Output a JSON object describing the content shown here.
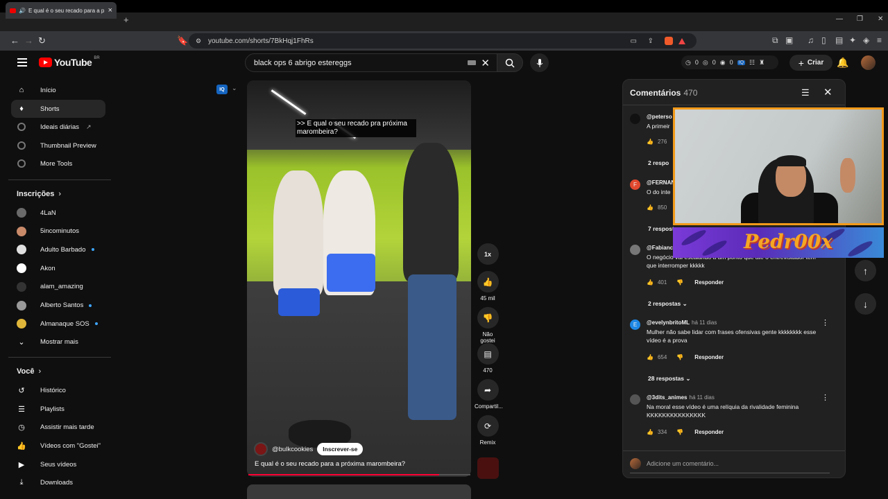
{
  "browser": {
    "tab_title": "E qual é o seu recado para a p",
    "url": "youtube.com/shorts/7BkHqj1FhRs"
  },
  "header": {
    "logo_text": "YouTube",
    "logo_country": "BR",
    "search_value": "black ops 6 abrigo estereggs",
    "counters": [
      "0",
      "0",
      "0"
    ],
    "create_label": "Criar"
  },
  "sidebar": {
    "main": [
      {
        "label": "Início",
        "icon": "home-icon"
      },
      {
        "label": "Shorts",
        "icon": "shorts-icon"
      },
      {
        "label": "Ideais diárias",
        "icon": "gear-icon"
      },
      {
        "label": "Thumbnail Preview",
        "icon": "gear-icon"
      },
      {
        "label": "More Tools",
        "icon": "gear-icon"
      }
    ],
    "subscriptions_header": "Inscrições",
    "subscriptions": [
      {
        "label": "4LaN",
        "dot": false,
        "color": "#6a6a6a"
      },
      {
        "label": "5incominutos",
        "dot": false,
        "color": "#c98a6a"
      },
      {
        "label": "Adulto Barbado",
        "dot": true,
        "color": "#e0e0e0"
      },
      {
        "label": "Akon",
        "dot": false,
        "color": "#ffffff"
      },
      {
        "label": "alam_amazing",
        "dot": false,
        "color": "#333333"
      },
      {
        "label": "Alberto Santos",
        "dot": true,
        "color": "#999999"
      },
      {
        "label": "Almanaque SOS",
        "dot": true,
        "color": "#e0b63a"
      }
    ],
    "show_more": "Mostrar mais",
    "you_header": "Você",
    "you_items": [
      {
        "label": "Histórico",
        "icon": "history-icon"
      },
      {
        "label": "Playlists",
        "icon": "playlists-icon"
      },
      {
        "label": "Assistir mais tarde",
        "icon": "clock-icon"
      },
      {
        "label": "Vídeos com \"Gostei\"",
        "icon": "like-icon"
      },
      {
        "label": "Seus vídeos",
        "icon": "video-icon"
      },
      {
        "label": "Downloads",
        "icon": "download-icon"
      }
    ]
  },
  "video": {
    "caption": ">> E qual o seu recado pra próxima marombeira?",
    "channel": "@bulkcookies",
    "subscribe_label": "Inscrever-se",
    "title": "E qual é o seu recado para a próxima marombeira?",
    "progress": 0.86
  },
  "actions": {
    "speed": "1x",
    "likes": "45 mil",
    "dislike_label": "Não gostei",
    "comments": "470",
    "share_label": "Compartil...",
    "remix_label": "Remix"
  },
  "comments": {
    "title": "Comentários",
    "count": "470",
    "items": [
      {
        "author": "@peterso",
        "ago": "",
        "text": "A primeir",
        "likes": "276",
        "replies": "2 respo",
        "avatar_color": "#111111",
        "initial": ""
      },
      {
        "author": "@FERNAN",
        "ago": "",
        "text": "O do inte",
        "likes": "850",
        "replies": "7 respostas",
        "avatar_color": "#e2492f",
        "initial": "F"
      },
      {
        "author": "@Fabianc",
        "ago": "",
        "text": "O negócio vai escalando a um ponto que até o entrevistador tem que interromper kkkkk",
        "likes": "401",
        "replies": "2 respostas",
        "avatar_color": "#777777",
        "initial": ""
      },
      {
        "author": "@evelynbritoML",
        "ago": "há 11 dias",
        "text": "Mulher não sabe lidar com frases ofensivas gente kkkkkkkk esse vídeo é a prova",
        "likes": "654",
        "replies": "28 respostas",
        "avatar_color": "#1e88e5",
        "initial": "E"
      },
      {
        "author": "@3dits_animes",
        "ago": "há 11 dias",
        "text": "Na moral esse vídeo é uma relíquia da rivalidade feminina KKKKKKKKKKKKKKK",
        "likes": "334",
        "replies": "",
        "avatar_color": "#555555",
        "initial": ""
      }
    ],
    "reply_label": "Responder",
    "input_placeholder": "Adicione um comentário..."
  },
  "overlay": {
    "logo": "Pedr00x"
  }
}
